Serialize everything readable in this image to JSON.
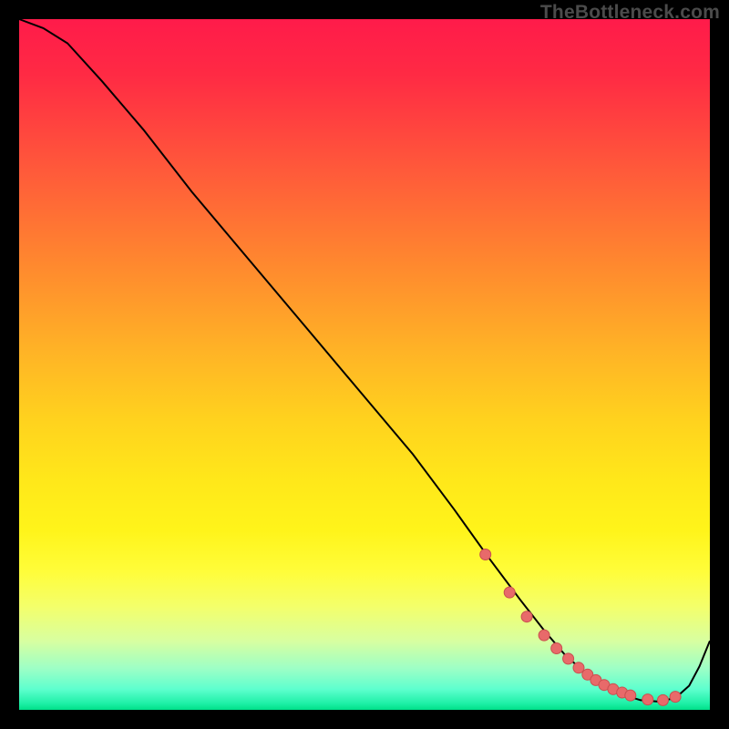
{
  "watermark": "TheBottleneck.com",
  "colors": {
    "line": "#000000",
    "dot_fill": "#e86a6a",
    "dot_stroke": "#c94f4f",
    "background": "#000000"
  },
  "chart_data": {
    "type": "line",
    "title": "",
    "xlabel": "",
    "ylabel": "",
    "xlim": [
      0,
      100
    ],
    "ylim": [
      0,
      100
    ],
    "grid": false,
    "legend": false,
    "series": [
      {
        "name": "curve",
        "x": [
          0,
          3.5,
          7,
          12,
          18,
          25,
          33,
          41,
          49,
          57,
          63,
          68,
          72.5,
          76,
          79,
          82,
          85,
          88,
          90,
          92.5,
          95,
          97,
          98.5,
          100
        ],
        "values": [
          100,
          98.7,
          96.5,
          91,
          84,
          75,
          65.5,
          56,
          46.5,
          37,
          29,
          22,
          16,
          11.5,
          8,
          5.3,
          3.3,
          2.0,
          1.4,
          1.2,
          1.7,
          3.5,
          6.3,
          10
        ]
      }
    ],
    "dots": {
      "name": "highlight-points",
      "x": [
        67.5,
        71,
        73.5,
        76,
        77.8,
        79.5,
        81,
        82.3,
        83.5,
        84.7,
        86,
        87.3,
        88.5,
        91,
        93.2,
        95
      ],
      "values": [
        22.5,
        17,
        13.5,
        10.8,
        8.9,
        7.4,
        6.1,
        5.1,
        4.3,
        3.6,
        3.0,
        2.5,
        2.1,
        1.5,
        1.4,
        1.9
      ]
    }
  }
}
